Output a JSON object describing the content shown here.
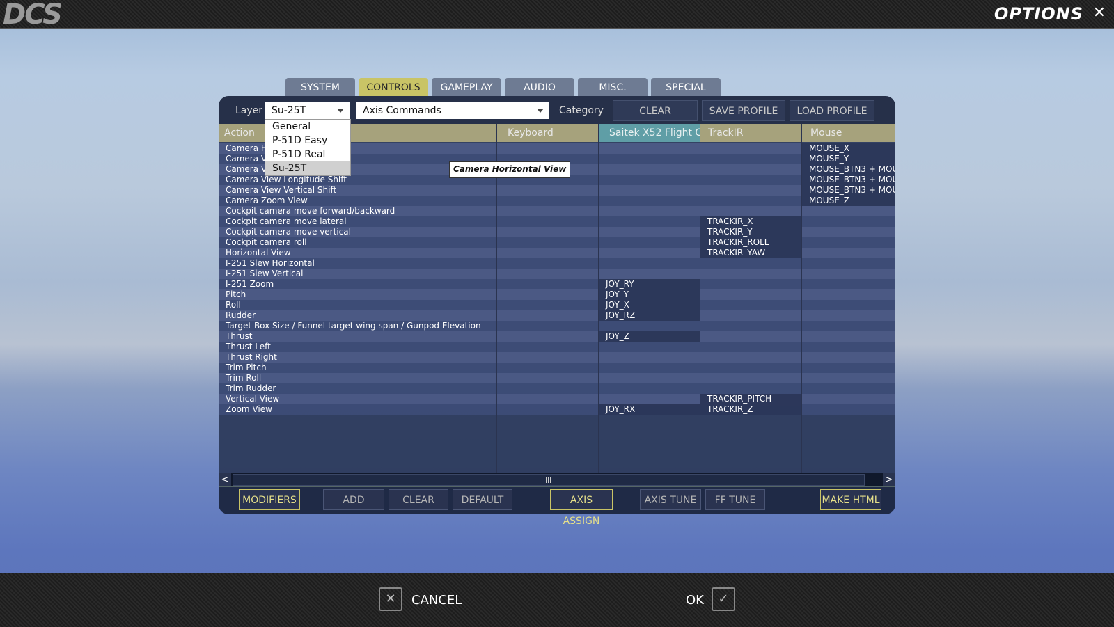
{
  "app": {
    "logo": "DCS",
    "title": "OPTIONS",
    "close_glyph": "✕"
  },
  "tabs": [
    {
      "label": "SYSTEM"
    },
    {
      "label": "CONTROLS"
    },
    {
      "label": "GAMEPLAY"
    },
    {
      "label": "AUDIO"
    },
    {
      "label": "MISC."
    },
    {
      "label": "SPECIAL"
    }
  ],
  "toolbar": {
    "layer_label": "Layer",
    "layer_value": "Su-25T",
    "commands_value": "Axis Commands",
    "category_label": "Category",
    "clear_category": "CLEAR CATEGORY",
    "save_profile_as": "SAVE PROFILE AS",
    "load_profile": "LOAD PROFILE"
  },
  "layer_options": [
    "General",
    "P-51D Easy",
    "P-51D Real",
    "Su-25T"
  ],
  "columns": {
    "action": "Action",
    "keyboard": "Keyboard",
    "saitek": "Saitek X52 Flight Co",
    "trackir": "TrackIR",
    "mouse": "Mouse"
  },
  "actions": [
    "Camera H",
    "Camera Vi",
    "Camera Vi",
    "Camera View Longitude Shift",
    "Camera View Vertical Shift",
    "Camera Zoom View",
    "Cockpit camera move forward/backward",
    "Cockpit camera move lateral",
    "Cockpit camera move vertical",
    "Cockpit camera roll",
    "Horizontal View",
    "I-251 Slew Horizontal",
    "I-251 Slew Vertical",
    "I-251 Zoom",
    "Pitch",
    "Roll",
    "Rudder",
    "Target Box Size / Funnel target wing span / Gunpod Elevation",
    "Thrust",
    "Thrust Left",
    "Thrust Right",
    "Trim Pitch",
    "Trim Roll",
    "Trim Rudder",
    "Vertical View",
    "Zoom View"
  ],
  "saitek_bindings": [
    "",
    "",
    "",
    "",
    "",
    "",
    "",
    "",
    "",
    "",
    "",
    "",
    "",
    "JOY_RY",
    "JOY_Y",
    "JOY_X",
    "JOY_RZ",
    "",
    "JOY_Z",
    "",
    "",
    "",
    "",
    "",
    "",
    "JOY_RX"
  ],
  "trackir_bindings": [
    "",
    "",
    "",
    "",
    "",
    "",
    "",
    "TRACKIR_X",
    "TRACKIR_Y",
    "TRACKIR_ROLL",
    "TRACKIR_YAW",
    "",
    "",
    "",
    "",
    "",
    "",
    "",
    "",
    "",
    "",
    "",
    "",
    "",
    "TRACKIR_PITCH",
    "TRACKIR_Z"
  ],
  "mouse_bindings": [
    "MOUSE_X",
    "MOUSE_Y",
    "MOUSE_BTN3 + MOUS",
    "MOUSE_BTN3 + MOUS",
    "MOUSE_BTN3 + MOUS",
    "MOUSE_Z",
    "",
    "",
    "",
    "",
    "",
    "",
    "",
    "",
    "",
    "",
    "",
    "",
    "",
    "",
    "",
    "",
    "",
    "",
    "",
    ""
  ],
  "tooltip": "Camera Horizontal View",
  "bottom": {
    "modifiers": "MODIFIERS",
    "add": "ADD",
    "clear": "CLEAR",
    "default": "DEFAULT",
    "axis_assign": "AXIS ASSIGN",
    "axis_tune": "AXIS TUNE",
    "ff_tune": "FF TUNE",
    "make_html": "MAKE HTML"
  },
  "scroll": {
    "left": "<",
    "right": ">"
  },
  "footer": {
    "cancel": "CANCEL",
    "ok": "OK",
    "cancel_glyph": "✕",
    "ok_glyph": "✓"
  }
}
